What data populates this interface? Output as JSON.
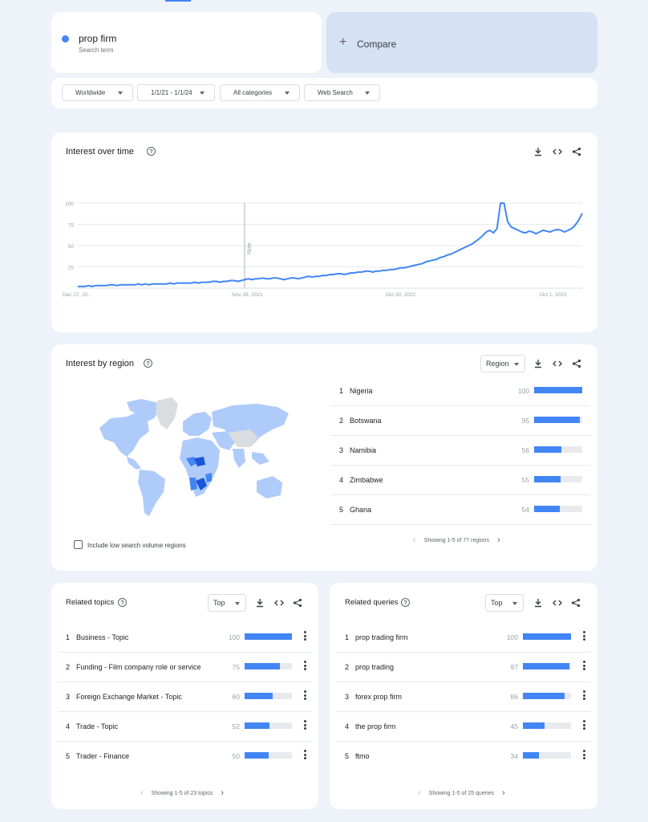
{
  "search": {
    "term": "prop firm",
    "term_type": "Search term",
    "term_color": "#4285f4",
    "compare_label": "Compare",
    "compare_icon": "plus-icon"
  },
  "filters": [
    {
      "label": "Worldwide"
    },
    {
      "label": "1/1/21 - 1/1/24"
    },
    {
      "label": "All categories"
    },
    {
      "label": "Web Search"
    }
  ],
  "interest_over_time": {
    "title": "Interest over time",
    "icons": [
      "help-icon",
      "download-icon",
      "embed-icon",
      "share-icon"
    ],
    "note_label": "Note",
    "chart_data": {
      "type": "line",
      "title": "",
      "xlabel": "",
      "ylabel": "",
      "ylim": [
        0,
        100
      ],
      "y_ticks": [
        "100",
        "75",
        "50",
        "25"
      ],
      "x_tick_labels": [
        "Dec 27, 20...",
        "Nov 28, 2021",
        "Oct 30, 2022",
        "Oct 1, 2023"
      ],
      "grid": true,
      "series_color": "#4285f4",
      "series": [
        {
          "values": [
            2,
            2,
            2,
            3,
            2,
            3,
            3,
            3,
            3,
            4,
            4,
            3,
            4,
            4,
            4,
            4,
            4,
            5,
            4,
            5,
            4,
            5,
            5,
            5,
            5,
            5,
            6,
            5,
            6,
            6,
            6,
            6,
            6,
            7,
            6,
            7,
            7,
            7,
            8,
            8,
            7,
            8,
            8,
            9,
            9,
            8,
            9,
            10,
            11,
            10,
            11,
            11,
            12,
            11,
            11,
            12,
            12,
            11,
            10,
            11,
            12,
            12,
            11,
            12,
            13,
            14,
            13,
            14,
            14,
            15,
            15,
            16,
            16,
            17,
            17,
            16,
            17,
            18,
            18,
            19,
            19,
            20,
            20,
            19,
            20,
            20,
            21,
            21,
            22,
            22,
            23,
            24,
            24,
            25,
            26,
            27,
            28,
            29,
            31,
            32,
            33,
            34,
            36,
            37,
            39,
            40,
            42,
            44,
            46,
            48,
            50,
            52,
            55,
            58,
            62,
            66,
            68,
            65,
            70,
            100,
            100,
            78,
            72,
            70,
            68,
            66,
            65,
            67,
            66,
            64,
            66,
            68,
            67,
            66,
            68,
            69,
            68,
            66,
            68,
            70,
            74,
            80,
            88
          ]
        }
      ]
    }
  },
  "interest_by_region": {
    "title": "Interest by region",
    "resolution_select": "Region",
    "low_volume_label": "Include low search volume regions",
    "map_colors": {
      "high": "#1a56db",
      "mid": "#4285f4",
      "low": "#aecbfa",
      "none": "#dadce0"
    },
    "regions": [
      {
        "rank": "1",
        "name": "Nigeria",
        "value": "100",
        "score": 100
      },
      {
        "rank": "2",
        "name": "Botswana",
        "value": "95",
        "score": 95
      },
      {
        "rank": "3",
        "name": "Namibia",
        "value": "56",
        "score": 56
      },
      {
        "rank": "4",
        "name": "Zimbabwe",
        "value": "55",
        "score": 55
      },
      {
        "rank": "5",
        "name": "Ghana",
        "value": "54",
        "score": 54
      }
    ],
    "pager": "Showing 1-5 of 77 regions"
  },
  "related_topics": {
    "title": "Related topics",
    "select": "Top",
    "items": [
      {
        "rank": "1",
        "name": "Business - Topic",
        "value": "100",
        "score": 100
      },
      {
        "rank": "2",
        "name": "Funding - Film company role or service",
        "value": "75",
        "score": 75
      },
      {
        "rank": "3",
        "name": "Foreign Exchange Market - Topic",
        "value": "60",
        "score": 60
      },
      {
        "rank": "4",
        "name": "Trade - Topic",
        "value": "52",
        "score": 52
      },
      {
        "rank": "5",
        "name": "Trader - Finance",
        "value": "50",
        "score": 50
      }
    ],
    "pager": "Showing 1-5 of 23 topics"
  },
  "related_queries": {
    "title": "Related queries",
    "select": "Top",
    "items": [
      {
        "rank": "1",
        "name": "prop trading firm",
        "value": "100",
        "score": 100
      },
      {
        "rank": "2",
        "name": "prop trading",
        "value": "97",
        "score": 97
      },
      {
        "rank": "3",
        "name": "forex prop firm",
        "value": "86",
        "score": 86
      },
      {
        "rank": "4",
        "name": "the prop firm",
        "value": "45",
        "score": 45
      },
      {
        "rank": "5",
        "name": "ftmo",
        "value": "34",
        "score": 34
      }
    ],
    "pager": "Showing 1-5 of 25 queries"
  }
}
